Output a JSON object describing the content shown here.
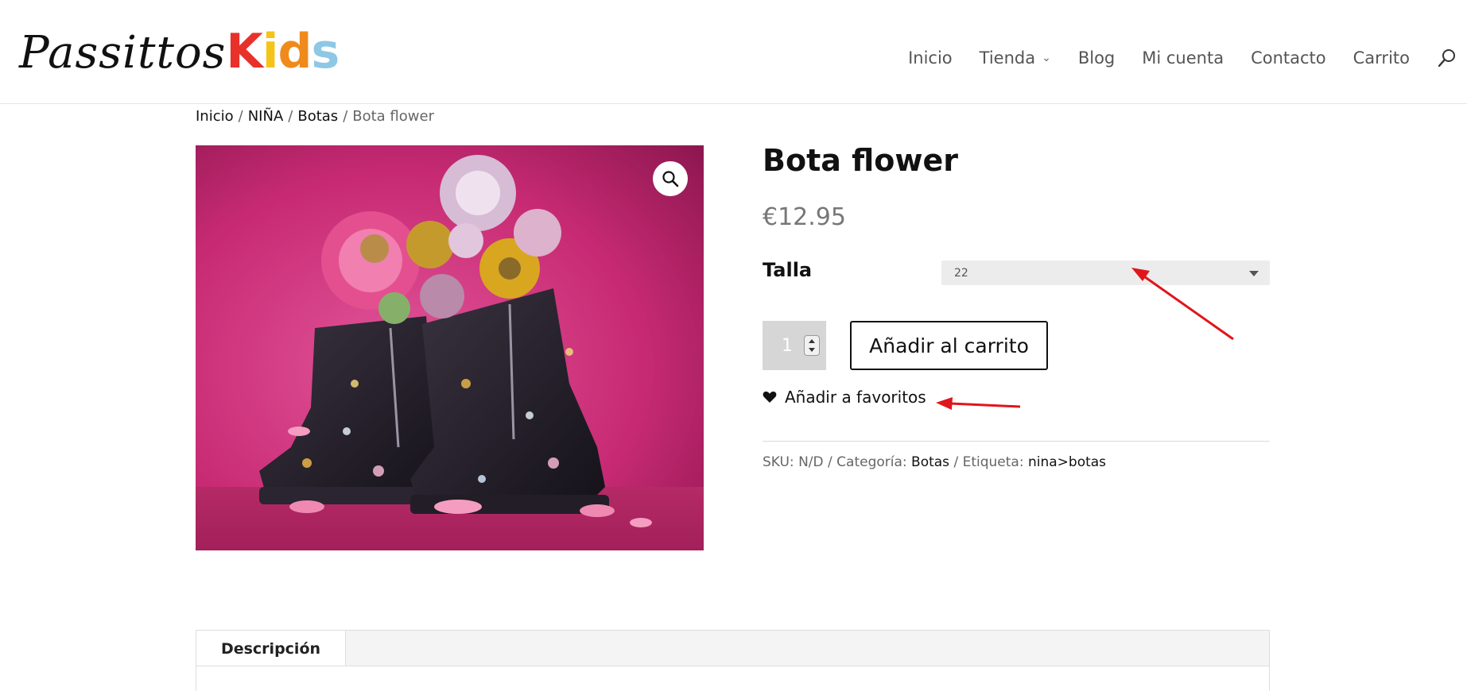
{
  "logo": {
    "part1": "Passittos",
    "part2_letters": [
      {
        "char": "K",
        "color": "#e8312a"
      },
      {
        "char": "i",
        "color": "#f5c418"
      },
      {
        "char": "d",
        "color": "#f08a1c"
      },
      {
        "char": "s",
        "color": "#8dc8e4"
      }
    ]
  },
  "nav": {
    "items": [
      "Inicio",
      "Tienda",
      "Blog",
      "Mi cuenta",
      "Contacto",
      "Carrito"
    ]
  },
  "breadcrumb": {
    "items": [
      "Inicio",
      "NIÑA",
      "Botas"
    ],
    "separator": "/",
    "current": "Bota flower"
  },
  "product": {
    "title": "Bota flower",
    "price": "€12.95",
    "talla_label": "Talla",
    "talla_value": "22",
    "quantity": "1",
    "add_to_cart": "Añadir al carrito",
    "wishlist": "Añadir a favoritos",
    "meta": {
      "sku_label": "SKU:",
      "sku_value": "N/D",
      "category_label": "Categoría:",
      "category_value": "Botas",
      "tag_label": "Etiqueta:",
      "tag_value": "nina>botas"
    }
  },
  "tabs": {
    "description": "Descripción"
  },
  "colors": {
    "annotation_arrow": "#e0161b",
    "image_background": "#c2276f"
  }
}
